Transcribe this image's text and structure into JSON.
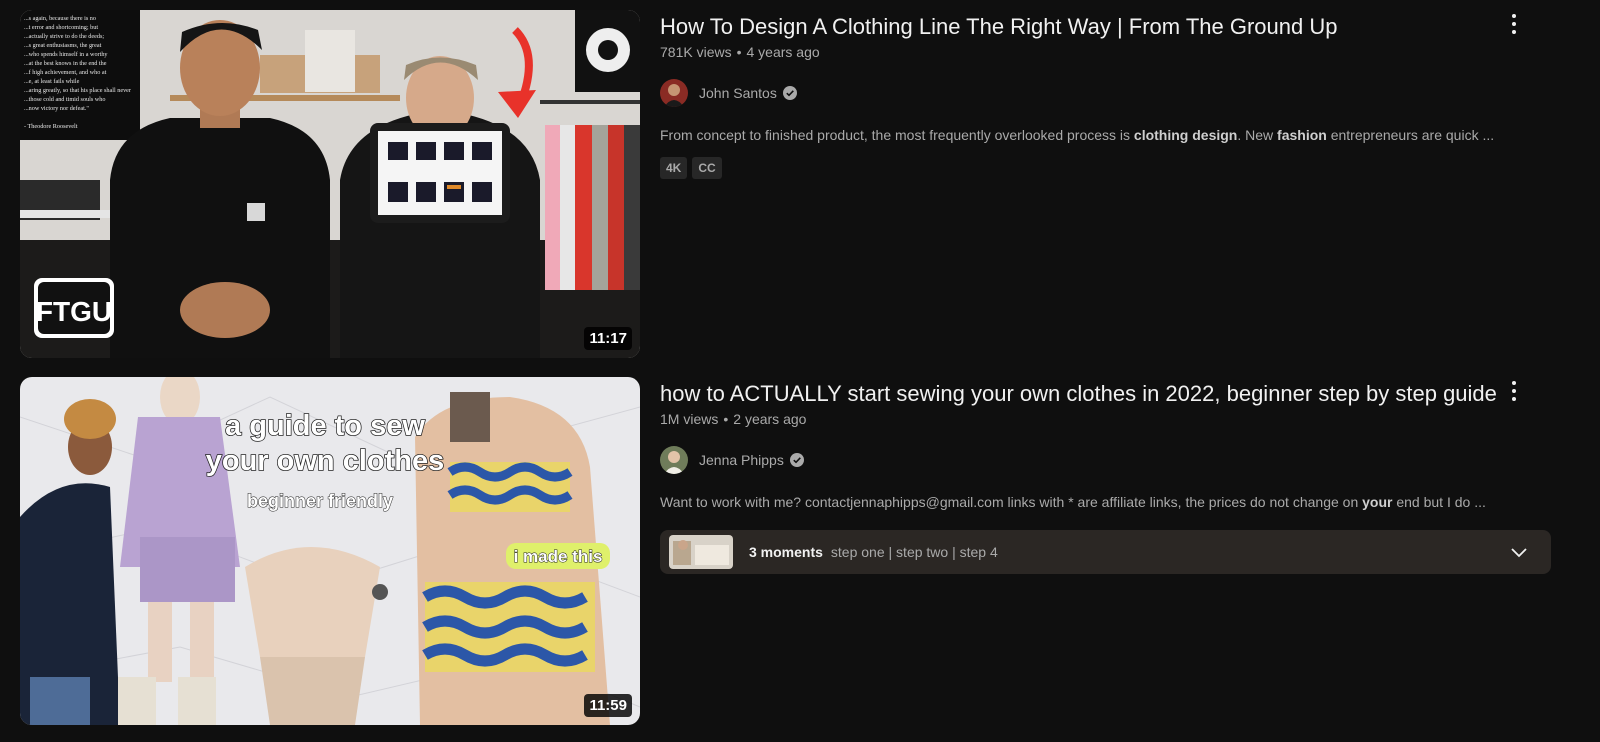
{
  "results": [
    {
      "title": "How To Design A Clothing Line The Right Way | From The Ground Up",
      "views": "781K views",
      "age": "4 years ago",
      "channel": "John Santos",
      "verified": true,
      "description_parts": [
        {
          "text": "From concept to finished product, the most frequently overlooked process is ",
          "bold": false
        },
        {
          "text": "clothing design",
          "bold": true
        },
        {
          "text": ". New ",
          "bold": false
        },
        {
          "text": "fashion",
          "bold": true
        },
        {
          "text": " entrepreneurs are quick ...",
          "bold": false
        }
      ],
      "badges": [
        "4K",
        "CC"
      ],
      "duration": "11:17",
      "thumbnail_logo": "FTGU",
      "thumbnail_quote": [
        "...s again, because there is no",
        "...t error and shortcoming; but",
        "...actually strive to do the deeds;",
        "...s great enthusiasms, the great",
        "...who spends himself in a worthy",
        "...at the best knows in the end the",
        "...f high achievement, and who at",
        "...e, at least fails while",
        "...aring greatly, so that his place shall never",
        "...those cold and timid souls who",
        "...now victory nor defeat.\"",
        "- Theodore Roosevelt"
      ]
    },
    {
      "title": "how to ACTUALLY start sewing your own clothes in 2022, beginner step by step guide",
      "views": "1M views",
      "age": "2 years ago",
      "channel": "Jenna Phipps",
      "verified": true,
      "description_parts": [
        {
          "text": "Want to work with me? contactjennaphipps@gmail.com links with * are affiliate links, the prices do not change on ",
          "bold": false
        },
        {
          "text": "your",
          "bold": true
        },
        {
          "text": " end but I do ...",
          "bold": false
        }
      ],
      "duration": "11:59",
      "thumbnail_text": [
        "a guide to sew",
        "your own clothes",
        "beginner friendly",
        "i made this"
      ],
      "moments": {
        "count": "3 moments",
        "list": "step one | step two | step 4"
      }
    }
  ],
  "icons": {
    "more": "more-vert-icon",
    "verified": "verified-check-icon",
    "expand": "chevron-down-icon"
  },
  "colors": {
    "background": "#0f0f0f",
    "title": "#f1f1f1",
    "secondary": "#aaaaaa",
    "badge_bg": "#272727",
    "moments_bg": "#2b2724",
    "arrow_red": "#e8322a"
  }
}
